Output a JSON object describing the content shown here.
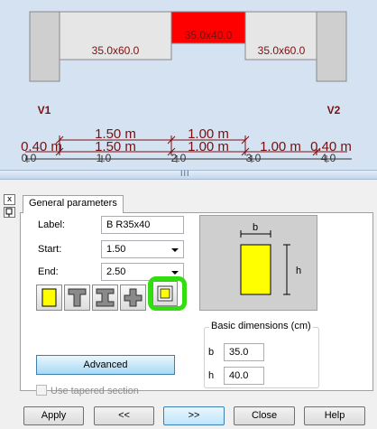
{
  "canvas": {
    "columns": [
      {
        "label": "V1"
      },
      {
        "label": "V2"
      }
    ],
    "beams": [
      {
        "section": "35.0x60.0",
        "selected": false
      },
      {
        "section": "35.0x40.0",
        "selected": true
      },
      {
        "section": "35.0x60.0",
        "selected": false
      }
    ],
    "span_dims_row1": [
      "1.50 m",
      "1.00 m"
    ],
    "span_dims_row2": [
      "0.40 m",
      "1.50 m",
      "1.00 m",
      "1.00 m",
      "0.40 m"
    ],
    "ruler_ticks": [
      "0.0",
      "1.0",
      "2.0",
      "3.0",
      "4.0"
    ],
    "colors": {
      "background": "#d4e2f2",
      "beam": "#e6e6e6",
      "column": "#cfcfcf",
      "selected_beam": "#ff0000",
      "dimension": "#7a1010"
    }
  },
  "splitter": {
    "grip": "III"
  },
  "side_buttons": {
    "close": "x",
    "pin": "pin-icon"
  },
  "tab": {
    "label": "General parameters"
  },
  "form": {
    "label_caption": "Label:",
    "label_value": "B R35x40",
    "start_caption": "Start:",
    "start_value": "1.50",
    "end_caption": "End:",
    "end_value": "2.50"
  },
  "section_types": [
    {
      "name": "rectangular-section-icon",
      "active": true
    },
    {
      "name": "t-section-icon",
      "active": false
    },
    {
      "name": "i-section-icon",
      "active": false
    },
    {
      "name": "cross-section-icon",
      "active": false
    },
    {
      "name": "tapered-rect-section-icon",
      "active": false
    }
  ],
  "advanced_label": "Advanced",
  "tapered_label": "Use tapered section",
  "preview": {
    "b_label": "b",
    "h_label": "h",
    "section_color": "#ffff00"
  },
  "dimensions": {
    "title": "Basic dimensions (cm)",
    "b_caption": "b",
    "b_value": "35.0",
    "h_caption": "h",
    "h_value": "40.0"
  },
  "buttons": {
    "apply": "Apply",
    "prev": "<<",
    "next": ">>",
    "close": "Close",
    "help": "Help"
  },
  "highlight_color": "#33dd11"
}
